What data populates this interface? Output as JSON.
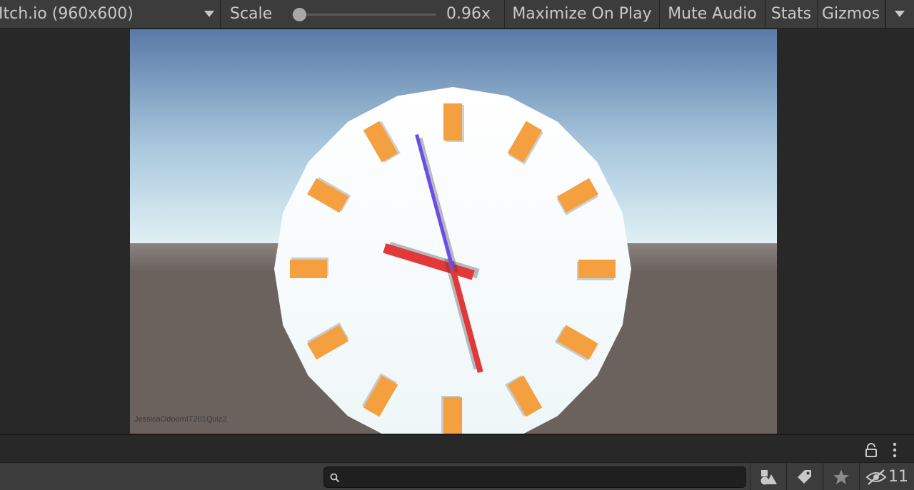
{
  "toolbar": {
    "resolution_label": "Itch.io (960x600)",
    "scale_label": "Scale",
    "scale_value_text": "0.96x",
    "scale_slider_fraction": 0.05,
    "maximize_label": "Maximize On Play",
    "mute_label": "Mute Audio",
    "stats_label": "Stats",
    "gizmos_label": "Gizmos"
  },
  "game": {
    "watermark": "JessicaOdoomIT201Quiz2",
    "clock": {
      "face_color": "#ffffff",
      "marker_color": "#f4a040",
      "hour_hand_color": "#e23838",
      "minute_hand_color": "#e23838",
      "second_hand_color": "#6a4ee8",
      "hour_count": 12,
      "hour_angle_deg": 287,
      "minute_angle_deg": 165,
      "second_angle_deg": 345
    },
    "colors": {
      "sky_top": "#587aa6",
      "sky_horizon": "#e0f0f4",
      "ground": "#6b625e"
    }
  },
  "bottom": {
    "search_value": "",
    "hidden_count": "11",
    "icons": {
      "lock": "lock-icon",
      "menu": "kebab-menu-icon",
      "search": "search-icon",
      "type_filter": "shapes-icon",
      "label_filter": "tag-icon",
      "favorites": "star-icon",
      "hidden": "eye-slash-icon"
    }
  }
}
